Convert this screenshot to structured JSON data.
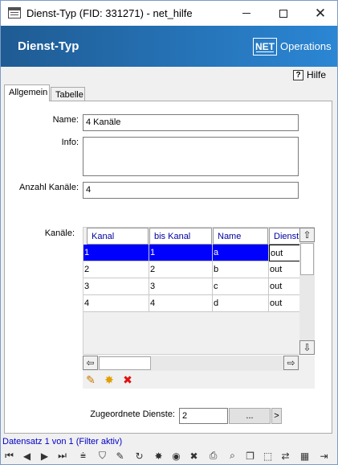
{
  "window": {
    "title": "Dienst-Typ (FID: 331271) - net_hilfe",
    "close_glyph": "✕"
  },
  "banner": {
    "title": "Dienst-Typ",
    "logo_text": "NET",
    "product_text": "Operations",
    "colors": {
      "start": "#1f5b93",
      "end": "#2b86d4"
    }
  },
  "help": {
    "icon_glyph": "?",
    "label": "Hilfe"
  },
  "tabs": [
    {
      "label": "Allgemein",
      "active": true
    },
    {
      "label": "Tabelle",
      "active": false
    }
  ],
  "form": {
    "name_label": "Name:",
    "name_value": "4 Kanäle",
    "info_label": "Info:",
    "info_value": "",
    "count_label": "Anzahl Kanäle:",
    "count_value": "4",
    "channels_label": "Kanäle:"
  },
  "grid": {
    "columns": [
      "Kanal",
      "bis Kanal",
      "Name",
      "Dienst"
    ],
    "rows": [
      [
        "1",
        "1",
        "a",
        "out"
      ],
      [
        "2",
        "2",
        "b",
        "out"
      ],
      [
        "3",
        "3",
        "c",
        "out"
      ],
      [
        "4",
        "4",
        "d",
        "out"
      ]
    ],
    "selected_row": 0,
    "selection_color": "#0000ff",
    "header_text_color": "#0000a0"
  },
  "grid_tools": [
    {
      "icon": "pencil-icon",
      "glyph": "✎",
      "color": "#c87800"
    },
    {
      "icon": "sparkle-new-icon",
      "glyph": "✸",
      "color": "#e0a000"
    },
    {
      "icon": "delete-x-icon",
      "glyph": "✖",
      "color": "#e01010"
    }
  ],
  "assigned": {
    "label": "Zugeordnete Dienste:",
    "value": "2",
    "ellipsis_label": "...",
    "next_label": ">"
  },
  "status": {
    "text": "Datensatz 1 von 1 (Filter aktiv)",
    "color": "#0000c8"
  },
  "navbar": [
    {
      "icon": "first-record-icon",
      "glyph": "⏮"
    },
    {
      "icon": "prev-record-icon",
      "glyph": "◀"
    },
    {
      "icon": "next-record-icon",
      "glyph": "▶"
    },
    {
      "icon": "last-record-icon",
      "glyph": "⏭"
    },
    {
      "icon": "filter-add-icon",
      "glyph": "⩧"
    },
    {
      "icon": "filter-icon",
      "glyph": "⛉"
    },
    {
      "icon": "edit-pencil-icon",
      "glyph": "✎"
    },
    {
      "icon": "refresh-icon",
      "glyph": "↻"
    },
    {
      "icon": "new-record-icon",
      "glyph": "✸"
    },
    {
      "icon": "globe-icon",
      "glyph": "◉"
    },
    {
      "icon": "delete-icon",
      "glyph": "✖"
    },
    {
      "icon": "print-icon",
      "glyph": "⎙"
    },
    {
      "icon": "search-icon",
      "glyph": "⌕"
    },
    {
      "icon": "copy-icon",
      "glyph": "❐"
    },
    {
      "icon": "select-icon",
      "glyph": "⬚"
    },
    {
      "icon": "transfer-icon",
      "glyph": "⇄"
    },
    {
      "icon": "table-columns-icon",
      "glyph": "▦"
    },
    {
      "icon": "exit-icon",
      "glyph": "⇥"
    }
  ]
}
